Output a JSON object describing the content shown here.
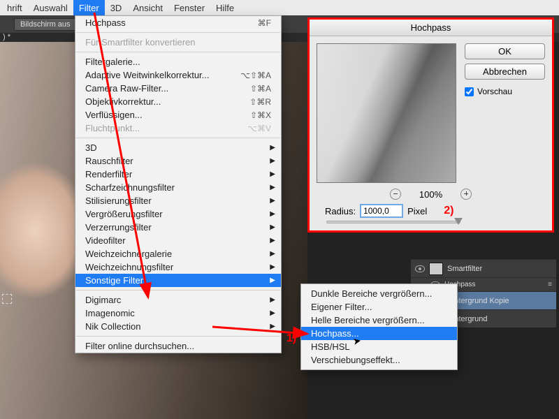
{
  "menubar": {
    "items": [
      "hrift",
      "Auswahl",
      "Filter",
      "3D",
      "Ansicht",
      "Fenster",
      "Hilfe"
    ],
    "active_index": 2
  },
  "toolbar": {
    "screen_btn": "Bildschirm aus"
  },
  "doc_tab": ") *",
  "menu": {
    "groups": [
      [
        {
          "label": "Hochpass",
          "shortcut": "⌘F",
          "disabled": false
        }
      ],
      [
        {
          "label": "Für Smartfilter konvertieren",
          "disabled": true
        }
      ],
      [
        {
          "label": "Filtergalerie...",
          "disabled": false
        },
        {
          "label": "Adaptive Weitwinkelkorrektur...",
          "shortcut": "⌥⇧⌘A",
          "disabled": false
        },
        {
          "label": "Camera Raw-Filter...",
          "shortcut": "⇧⌘A",
          "disabled": false
        },
        {
          "label": "Objektivkorrektur...",
          "shortcut": "⇧⌘R",
          "disabled": false
        },
        {
          "label": "Verflüssigen...",
          "shortcut": "⇧⌘X",
          "disabled": false
        },
        {
          "label": "Fluchtpunkt...",
          "shortcut": "⌥⌘V",
          "disabled": true
        }
      ],
      [
        {
          "label": "3D",
          "submenu": true
        },
        {
          "label": "Rauschfilter",
          "submenu": true
        },
        {
          "label": "Renderfilter",
          "submenu": true
        },
        {
          "label": "Scharfzeichnungsfilter",
          "submenu": true
        },
        {
          "label": "Stilisierungsfilter",
          "submenu": true
        },
        {
          "label": "Vergrößerungsfilter",
          "submenu": true
        },
        {
          "label": "Verzerrungsfilter",
          "submenu": true
        },
        {
          "label": "Videofilter",
          "submenu": true
        },
        {
          "label": "Weichzeichnergalerie",
          "submenu": true
        },
        {
          "label": "Weichzeichnungsfilter",
          "submenu": true
        },
        {
          "label": "Sonstige Filter",
          "submenu": true,
          "highlight": true
        }
      ],
      [
        {
          "label": "Digimarc",
          "submenu": true
        },
        {
          "label": "Imagenomic",
          "submenu": true
        },
        {
          "label": "Nik Collection",
          "submenu": true
        }
      ],
      [
        {
          "label": "Filter online durchsuchen..."
        }
      ]
    ]
  },
  "submenu": {
    "items": [
      {
        "label": "Dunkle Bereiche vergrößern..."
      },
      {
        "label": "Eigener Filter..."
      },
      {
        "label": "Helle Bereiche vergrößern..."
      },
      {
        "label": "Hochpass...",
        "highlight": true
      },
      {
        "label": "HSB/HSL"
      },
      {
        "label": "Verschiebungseffekt..."
      }
    ]
  },
  "dialog": {
    "title": "Hochpass",
    "ok": "OK",
    "cancel": "Abbrechen",
    "preview_label": "Vorschau",
    "preview_checked": true,
    "zoom_pct": "100%",
    "radius_label": "Radius:",
    "radius_value": "1000,0",
    "radius_unit": "Pixel"
  },
  "layers": {
    "items": [
      {
        "name": "Smartfilter",
        "child": false
      },
      {
        "name": "Hochpass",
        "child": true
      },
      {
        "name": "Hintergrund Kopie",
        "child": false,
        "selected": true
      },
      {
        "name": "Hintergrund",
        "child": false
      }
    ]
  },
  "annotations": {
    "step1": "1)",
    "step2": "2)"
  }
}
